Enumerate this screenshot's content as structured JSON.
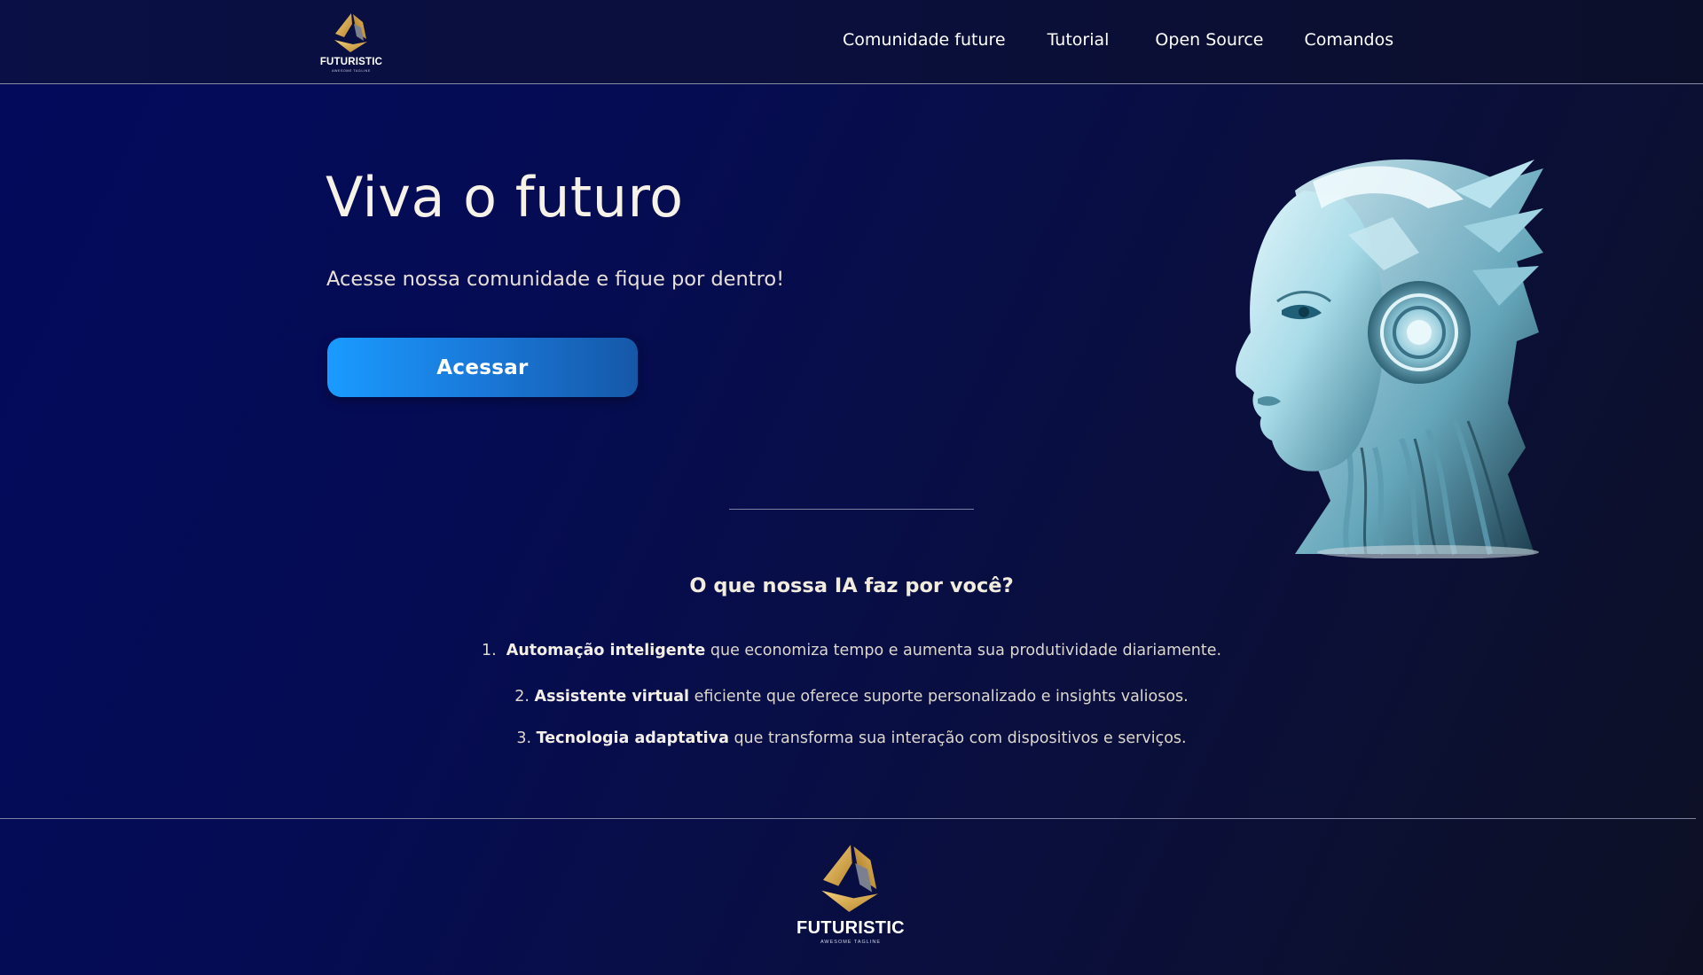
{
  "header": {
    "logo": {
      "name": "FUTURISTIC",
      "tagline": "AWESOME TAGLINE"
    },
    "nav": [
      {
        "label": "Comunidade future"
      },
      {
        "label": "Tutorial"
      },
      {
        "label": "Open Source"
      },
      {
        "label": "Comandos"
      }
    ]
  },
  "hero": {
    "title": "Viva o futuro",
    "subtitle": "Acesse nossa comunidade e fique por dentro!",
    "cta_label": "Acessar",
    "illustration": "robot-head-illustration"
  },
  "features": {
    "title": "O que nossa IA faz por você?",
    "items": [
      {
        "number": "1.",
        "bold": "Automação inteligente",
        "text": " que economiza tempo e aumenta sua produtividade diariamente."
      },
      {
        "number": "2.",
        "bold": "Assistente virtual",
        "text": " eficiente que oferece suporte personalizado e insights valiosos."
      },
      {
        "number": "3.",
        "bold": "Tecnologia adaptativa",
        "text": " que transforma sua interação com dispositivos e serviços."
      }
    ]
  },
  "footer": {
    "logo": {
      "name": "FUTURISTIC",
      "tagline": "AWESOME TAGLINE"
    }
  },
  "colors": {
    "background": "#030a5c",
    "button_start": "#1a9bff",
    "button_end": "#1558a8",
    "logo_gold": "#d9a84a",
    "text": "#f2ecdf"
  }
}
